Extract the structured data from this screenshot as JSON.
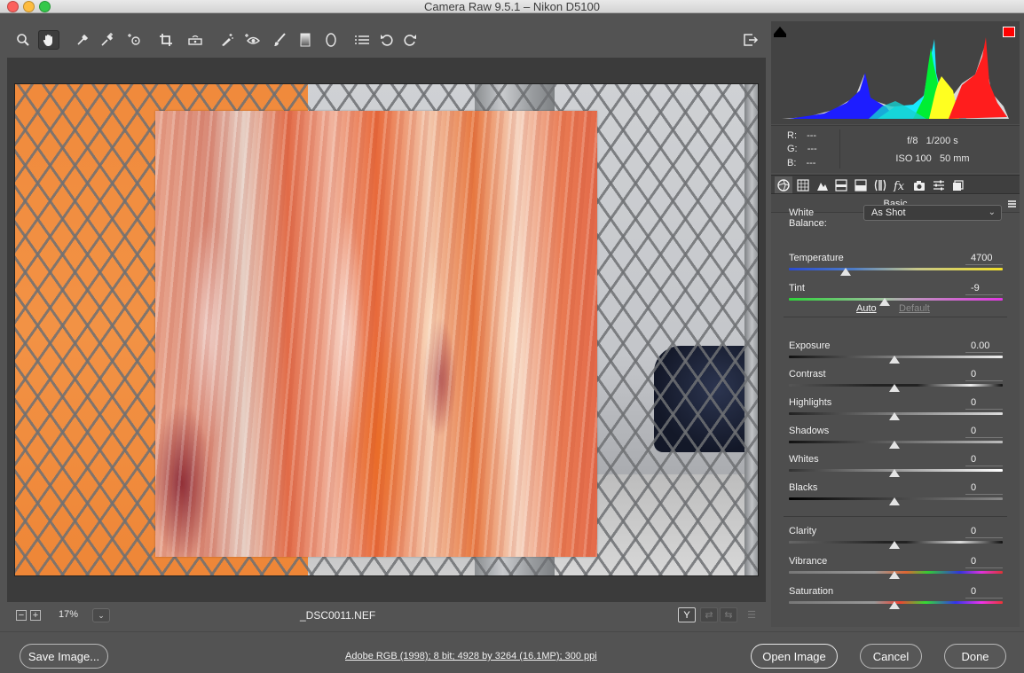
{
  "window": {
    "title": "Camera Raw 9.5.1  –  Nikon D5100"
  },
  "toolbar": {
    "tools": [
      {
        "name": "zoom-tool",
        "icon": "magnifier-icon"
      },
      {
        "name": "hand-tool",
        "icon": "hand-icon",
        "active": true
      },
      {
        "name": "white-balance-tool",
        "icon": "eyedropper-icon"
      },
      {
        "name": "color-sampler-tool",
        "icon": "color-sampler-icon"
      },
      {
        "name": "targeted-adjustment-tool",
        "icon": "target-adjust-icon"
      },
      {
        "name": "crop-tool",
        "icon": "crop-icon"
      },
      {
        "name": "straighten-tool",
        "icon": "level-icon"
      },
      {
        "name": "spot-removal-tool",
        "icon": "spot-removal-icon"
      },
      {
        "name": "red-eye-tool",
        "icon": "red-eye-icon"
      },
      {
        "name": "adjustment-brush-tool",
        "icon": "brush-icon"
      },
      {
        "name": "graduated-filter-tool",
        "icon": "graduated-filter-icon"
      },
      {
        "name": "radial-filter-tool",
        "icon": "radial-filter-icon"
      },
      {
        "name": "preferences-tool",
        "icon": "list-icon"
      },
      {
        "name": "rotate-ccw-tool",
        "icon": "rotate-left-icon"
      },
      {
        "name": "rotate-cw-tool",
        "icon": "rotate-right-icon"
      }
    ],
    "fullscreen_icon": "fullscreen-icon"
  },
  "preview": {
    "zoom_out": "−",
    "zoom_in": "+",
    "zoom_value": "17%",
    "zoom_dropdown": "⌄",
    "filename": "_DSC0011.NEF",
    "view_buttons": [
      "Y",
      "⇄",
      "⇆",
      "☰"
    ]
  },
  "info": {
    "r_label": "R:",
    "g_label": "G:",
    "b_label": "B:",
    "r_value": "---",
    "g_value": "---",
    "b_value": "---",
    "aperture": "f/8",
    "shutter": "1/200 s",
    "iso": "ISO 100",
    "focal_length": "50 mm"
  },
  "panel": {
    "section_title": "Basic",
    "tabs": [
      "basic-tab-icon",
      "tone-curve-tab-icon",
      "detail-tab-icon",
      "hsl-tab-icon",
      "split-toning-tab-icon",
      "lens-corrections-tab-icon",
      "effects-tab-icon",
      "camera-calibration-tab-icon",
      "presets-tab-icon",
      "snapshots-tab-icon"
    ],
    "white_balance_label": "White Balance:",
    "white_balance_value": "As Shot",
    "auto_label": "Auto",
    "default_label": "Default",
    "sliders": {
      "temperature": {
        "label": "Temperature",
        "value": "4700"
      },
      "tint": {
        "label": "Tint",
        "value": "-9"
      },
      "exposure": {
        "label": "Exposure",
        "value": "0.00"
      },
      "contrast": {
        "label": "Contrast",
        "value": "0"
      },
      "highlights": {
        "label": "Highlights",
        "value": "0"
      },
      "shadows": {
        "label": "Shadows",
        "value": "0"
      },
      "whites": {
        "label": "Whites",
        "value": "0"
      },
      "blacks": {
        "label": "Blacks",
        "value": "0"
      },
      "clarity": {
        "label": "Clarity",
        "value": "0"
      },
      "vibrance": {
        "label": "Vibrance",
        "value": "0"
      },
      "saturation": {
        "label": "Saturation",
        "value": "0"
      }
    }
  },
  "bottom": {
    "save_label": "Save Image...",
    "workflow_text": "Adobe RGB (1998); 8 bit; 4928 by 3264 (16.1MP); 300 ppi",
    "open_label": "Open Image",
    "cancel_label": "Cancel",
    "done_label": "Done"
  },
  "colors": {
    "panel_bg": "#535353",
    "shadow_clip": "#000000",
    "highlight_clip": "#ff0000"
  }
}
